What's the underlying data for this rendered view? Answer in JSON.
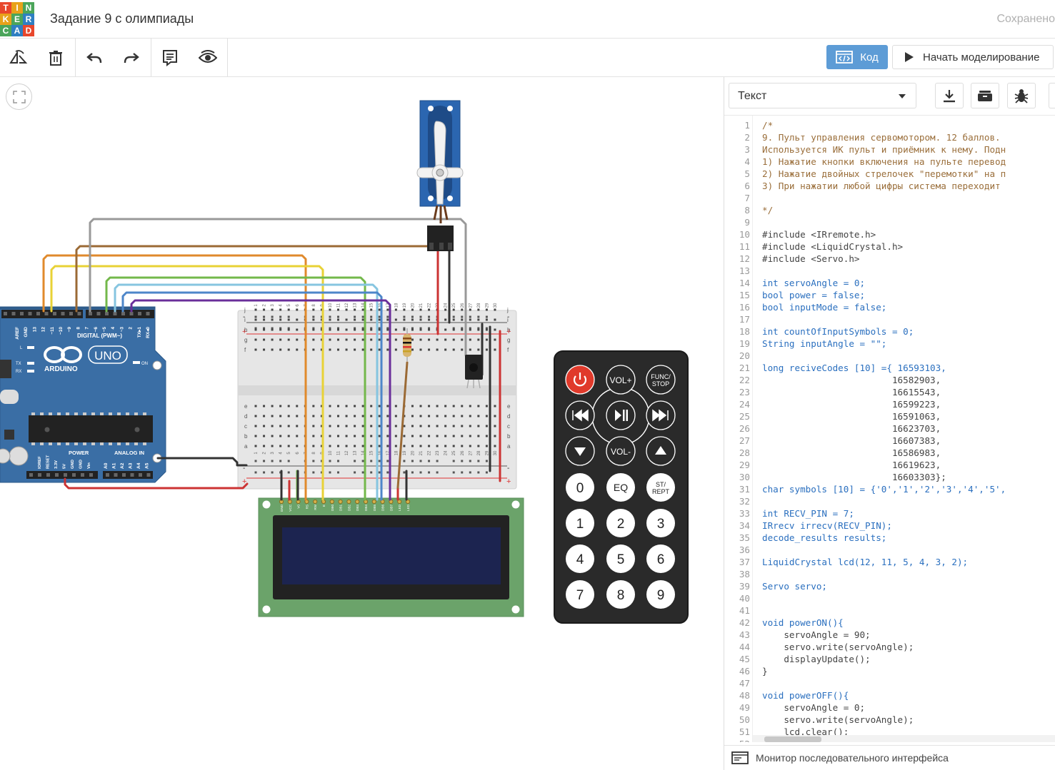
{
  "header": {
    "logo_letters": [
      "TIN",
      "KER",
      "CAD"
    ],
    "logo_colors": [
      "#e8472c",
      "#e8a21a",
      "#4ba55a",
      "#2f7fc2"
    ],
    "design_title": "Задание 9 с олимпиады",
    "save_status": "Сохранено"
  },
  "toolbar": {
    "icons": [
      "rotate-icon",
      "delete-icon",
      "undo-icon",
      "redo-icon",
      "notes-icon",
      "visibility-icon"
    ],
    "code_label": "Код",
    "simulate_label": "Начать моделирование"
  },
  "code_panel": {
    "mode": "Текст",
    "icons": [
      "download-icon",
      "library-icon",
      "debug-icon"
    ],
    "serial_monitor_label": "Монитор последовательного интерфейса"
  },
  "code": [
    {
      "n": "1",
      "t": "/*"
    },
    {
      "n": "2",
      "t": "9. Пульт управления сервомотором. 12 баллов."
    },
    {
      "n": "3",
      "t": "Используется ИК пульт и приёмник к нему. Подн"
    },
    {
      "n": "4",
      "t": "1) Нажатие кнопки включения на пульте перевод"
    },
    {
      "n": "5",
      "t": "2) Нажатие двойных стрелочек \"перемотки\" на п"
    },
    {
      "n": "6",
      "t": "3) При нажатии любой цифры система переходит "
    },
    {
      "n": "7",
      "t": ""
    },
    {
      "n": "8",
      "t": "*/"
    },
    {
      "n": "9",
      "t": ""
    },
    {
      "n": "10",
      "t": "#include <IRremote.h>"
    },
    {
      "n": "11",
      "t": "#include <LiquidCrystal.h>"
    },
    {
      "n": "12",
      "t": "#include <Servo.h>"
    },
    {
      "n": "13",
      "t": ""
    },
    {
      "n": "14",
      "t": "int servoAngle = 0;"
    },
    {
      "n": "15",
      "t": "bool power = false;"
    },
    {
      "n": "16",
      "t": "bool inputMode = false;"
    },
    {
      "n": "17",
      "t": ""
    },
    {
      "n": "18",
      "t": "int countOfInputSymbols = 0;"
    },
    {
      "n": "19",
      "t": "String inputAngle = \"\";"
    },
    {
      "n": "20",
      "t": ""
    },
    {
      "n": "21",
      "t": "long reciveCodes [10] ={ 16593103,"
    },
    {
      "n": "22",
      "t": "                        16582903,"
    },
    {
      "n": "23",
      "t": "                        16615543,"
    },
    {
      "n": "24",
      "t": "                        16599223,"
    },
    {
      "n": "25",
      "t": "                        16591063,"
    },
    {
      "n": "26",
      "t": "                        16623703,"
    },
    {
      "n": "27",
      "t": "                        16607383,"
    },
    {
      "n": "28",
      "t": "                        16586983,"
    },
    {
      "n": "29",
      "t": "                        16619623,"
    },
    {
      "n": "30",
      "t": "                        16603303};"
    },
    {
      "n": "31",
      "t": "char symbols [10] = {'0','1','2','3','4','5',"
    },
    {
      "n": "32",
      "t": ""
    },
    {
      "n": "33",
      "t": "int RECV_PIN = 7;"
    },
    {
      "n": "34",
      "t": "IRrecv irrecv(RECV_PIN);"
    },
    {
      "n": "35",
      "t": "decode_results results;"
    },
    {
      "n": "36",
      "t": ""
    },
    {
      "n": "37",
      "t": "LiquidCrystal lcd(12, 11, 5, 4, 3, 2);"
    },
    {
      "n": "38",
      "t": ""
    },
    {
      "n": "39",
      "t": "Servo servo;"
    },
    {
      "n": "40",
      "t": ""
    },
    {
      "n": "41",
      "t": ""
    },
    {
      "n": "42",
      "t": "void powerON(){"
    },
    {
      "n": "43",
      "t": "    servoAngle = 90;"
    },
    {
      "n": "44",
      "t": "    servo.write(servoAngle);"
    },
    {
      "n": "45",
      "t": "    displayUpdate();"
    },
    {
      "n": "46",
      "t": "}"
    },
    {
      "n": "47",
      "t": ""
    },
    {
      "n": "48",
      "t": "void powerOFF(){"
    },
    {
      "n": "49",
      "t": "    servoAngle = 0;"
    },
    {
      "n": "50",
      "t": "    servo.write(servoAngle);"
    },
    {
      "n": "51",
      "t": "    lcd.clear();"
    },
    {
      "n": "52",
      "t": ""
    }
  ],
  "circuit": {
    "arduino": {
      "brand": "ARDUINO",
      "model": "UNO",
      "digital_label": "DIGITAL (PWM~)",
      "power_label": "POWER",
      "analog_label": "ANALOG IN",
      "on_label": "ON",
      "l_label": "L",
      "tx_label": "TX",
      "rx_label": "RX",
      "digital_pins": [
        "AREF",
        "GND",
        "13",
        "12",
        "~11",
        "~10",
        "~9",
        "8",
        "7",
        "~6",
        "~5",
        "4",
        "~3",
        "2",
        "TX▸1",
        "RX◂0"
      ],
      "power_pins": [
        "IOREF",
        "RESET",
        "3.3V",
        "5V",
        "GND",
        "GND",
        "Vin"
      ],
      "analog_pins": [
        "A0",
        "A1",
        "A2",
        "A3",
        "A4",
        "A5"
      ]
    },
    "breadboard": {
      "row_letters_top": [
        "j",
        "i",
        "h",
        "g",
        "f"
      ],
      "row_letters_bottom": [
        "e",
        "d",
        "c",
        "b",
        "a"
      ],
      "columns": [
        "1",
        "2",
        "3",
        "4",
        "5",
        "6",
        "7",
        "8",
        "9",
        "10",
        "11",
        "12",
        "13",
        "14",
        "15",
        "16",
        "17",
        "18",
        "19",
        "20",
        "21",
        "22",
        "23",
        "24",
        "25",
        "26",
        "27",
        "28",
        "29",
        "30"
      ],
      "plus": "+",
      "minus": "-"
    },
    "lcd": {
      "pins": [
        "GND",
        "VCC",
        "V0",
        "RS",
        "RW",
        "E",
        "DB0",
        "DB1",
        "DB2",
        "DB3",
        "DB4",
        "DB5",
        "DB6",
        "DB7",
        "LED",
        "LED"
      ]
    },
    "remote": {
      "buttons": [
        [
          "power-icon",
          "VOL+",
          "FUNC/\nSTOP"
        ],
        [
          "prev-icon",
          "play-pause-icon",
          "next-icon"
        ],
        [
          "down-icon",
          "VOL-",
          "up-icon"
        ],
        [
          "0",
          "EQ",
          "ST/\nREPT"
        ],
        [
          "1",
          "2",
          "3"
        ],
        [
          "4",
          "5",
          "6"
        ],
        [
          "7",
          "8",
          "9"
        ]
      ]
    }
  }
}
